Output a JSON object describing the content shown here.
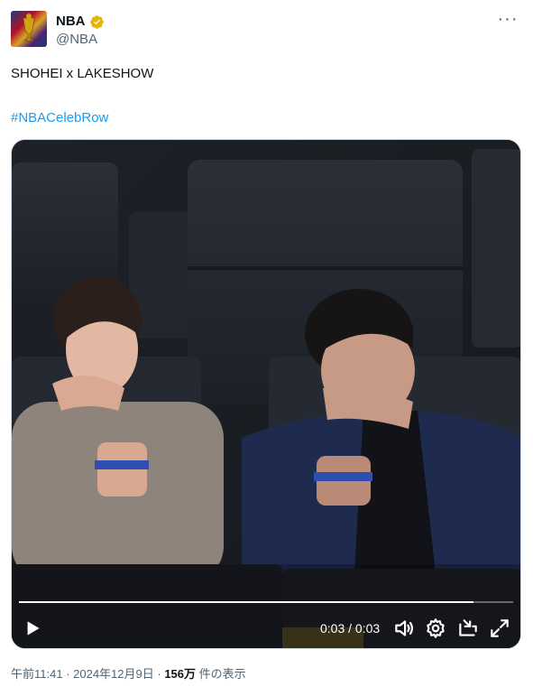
{
  "account": {
    "name": "NBA",
    "handle": "@NBA",
    "verified_color": "#e8b400"
  },
  "post": {
    "text": "SHOHEI x LAKESHOW",
    "hashtag": "#NBACelebRow"
  },
  "video": {
    "current_time": "0:03",
    "separator": " / ",
    "duration": "0:03",
    "progress_fraction": 0.92
  },
  "meta": {
    "time": "午前11:41",
    "dot": " · ",
    "date": "2024年12月9日",
    "dot2": " · ",
    "views": "156万",
    "views_suffix": " 件の表示"
  },
  "icons": {
    "more": "more-dots-icon",
    "play": "play-icon",
    "volume": "volume-icon",
    "settings": "settings-gear-icon",
    "pip": "picture-in-picture-icon",
    "fullscreen": "fullscreen-icon"
  }
}
